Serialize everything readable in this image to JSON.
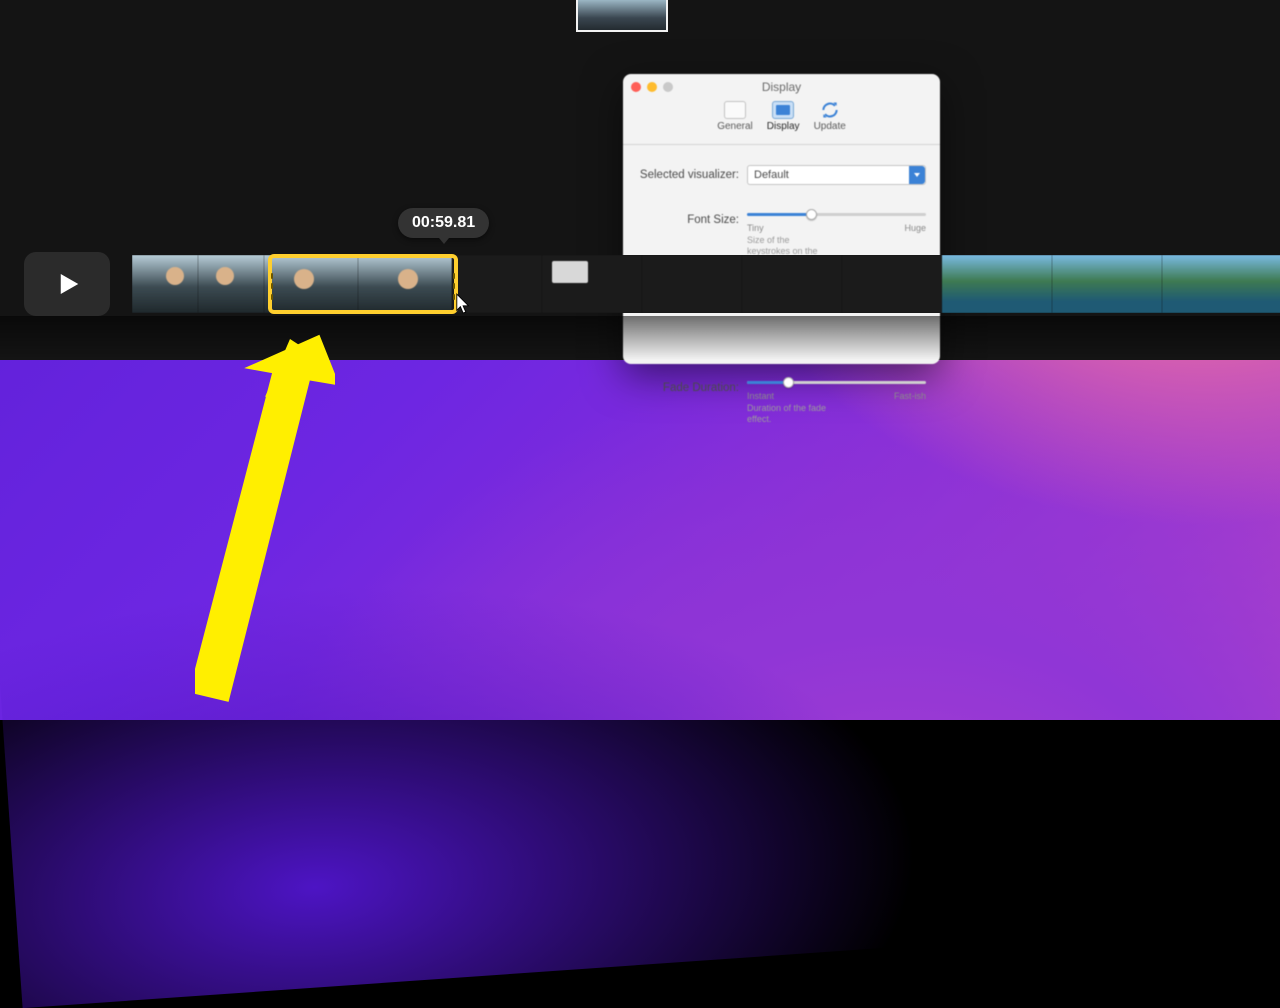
{
  "dialog": {
    "title": "Display",
    "tabs": {
      "general": "General",
      "display": "Display",
      "update": "Update"
    },
    "rows": {
      "visualizer": {
        "label": "Selected visualizer:",
        "value": "Default"
      },
      "fontsize": {
        "label": "Font Size:",
        "hint": "Size of the keystrokes on the bezel.",
        "min": "Tiny",
        "max": "Huge"
      },
      "fade": {
        "label": "Fade Duration:",
        "hint": "Duration of the fade effect.",
        "min": "Instant",
        "max": "Fast-ish"
      }
    }
  },
  "timeline": {
    "timestamp": "00:59.81"
  }
}
